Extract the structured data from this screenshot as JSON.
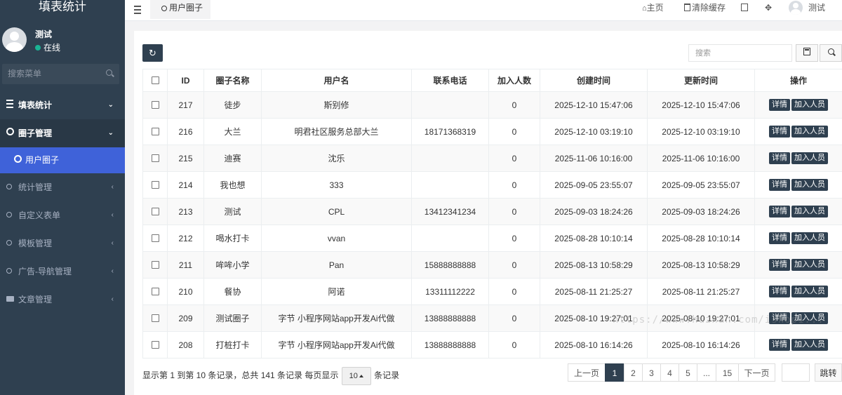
{
  "sidebar": {
    "brand": "填表统计",
    "user": {
      "name": "测试",
      "status": "在线"
    },
    "search_placeholder": "搜索菜单",
    "menu": [
      {
        "label": "填表统计",
        "icon": "list-icon",
        "state": "open"
      },
      {
        "label": "圈子管理",
        "icon": "circle-icon",
        "state": "active"
      },
      {
        "label": "用户圈子",
        "icon": "circle-icon",
        "state": "selected-sub"
      },
      {
        "label": "统计管理",
        "icon": "circle-icon",
        "state": "collapsed"
      },
      {
        "label": "自定义表单",
        "icon": "circle-icon",
        "state": "collapsed"
      },
      {
        "label": "模板管理",
        "icon": "circle-icon",
        "state": "collapsed"
      },
      {
        "label": "广告-导航管理",
        "icon": "circle-icon",
        "state": "collapsed"
      },
      {
        "label": "文章管理",
        "icon": "book-icon",
        "state": "collapsed"
      }
    ]
  },
  "topbar": {
    "tab_label": "用户圈子",
    "home": "主页",
    "clear_cache": "清除缓存",
    "user_name": "测试"
  },
  "toolbar": {
    "search_placeholder": "搜索"
  },
  "table": {
    "columns": [
      "ID",
      "圈子名称",
      "用户名",
      "联系电话",
      "加入人数",
      "创建时间",
      "更新时间",
      "操作"
    ],
    "action_details": "详情",
    "action_join": "加入人员",
    "rows": [
      {
        "id": "217",
        "name": "徒步",
        "user": "斯别修",
        "phone": "",
        "count": "0",
        "created": "2025-12-10 15:47:06",
        "updated": "2025-12-10 15:47:06"
      },
      {
        "id": "216",
        "name": "大兰",
        "user": "明君社区服务总部大兰",
        "phone": "18171368319",
        "count": "0",
        "created": "2025-12-10 03:19:10",
        "updated": "2025-12-10 03:19:10"
      },
      {
        "id": "215",
        "name": "迪赛",
        "user": "沈乐",
        "phone": "",
        "count": "0",
        "created": "2025-11-06 10:16:00",
        "updated": "2025-11-06 10:16:00"
      },
      {
        "id": "214",
        "name": "我也想",
        "user": "333",
        "phone": "",
        "count": "0",
        "created": "2025-09-05 23:55:07",
        "updated": "2025-09-05 23:55:07"
      },
      {
        "id": "213",
        "name": "测试",
        "user": "CPL",
        "phone": "13412341234",
        "count": "0",
        "created": "2025-09-03 18:24:26",
        "updated": "2025-09-03 18:24:26"
      },
      {
        "id": "212",
        "name": "喝水打卡",
        "user": "vvan",
        "phone": "",
        "count": "0",
        "created": "2025-08-28 10:10:14",
        "updated": "2025-08-28 10:10:14"
      },
      {
        "id": "211",
        "name": "哞哞小学",
        "user": "Pan",
        "phone": "15888888888",
        "count": "0",
        "created": "2025-08-13 10:58:29",
        "updated": "2025-08-13 10:58:29"
      },
      {
        "id": "210",
        "name": "餐协",
        "user": "阿诺",
        "phone": "13311112222",
        "count": "0",
        "created": "2025-08-11 21:25:27",
        "updated": "2025-08-11 21:25:27"
      },
      {
        "id": "209",
        "name": "测试圈子",
        "user": "字节 小程序网站app开发Ai代做",
        "phone": "13888888888",
        "count": "0",
        "created": "2025-08-10 19:27:01",
        "updated": "2025-08-10 19:27:01"
      },
      {
        "id": "208",
        "name": "打桩打卡",
        "user": "字节 小程序网站app开发Ai代做",
        "phone": "13888888888",
        "count": "0",
        "created": "2025-08-10 16:14:26",
        "updated": "2025-08-10 16:14:26"
      }
    ]
  },
  "pagination": {
    "info_prefix": "显示第 1 到第 10 条记录，总共 141 条记录 每页显示",
    "page_size": "10",
    "info_suffix": "条记录",
    "prev": "上一页",
    "pages": [
      "1",
      "2",
      "3",
      "4",
      "5",
      "...",
      "15"
    ],
    "current": "1",
    "next": "下一页",
    "jump": "跳转"
  },
  "watermark": "https://www.huzhan.com/ishop1..."
}
